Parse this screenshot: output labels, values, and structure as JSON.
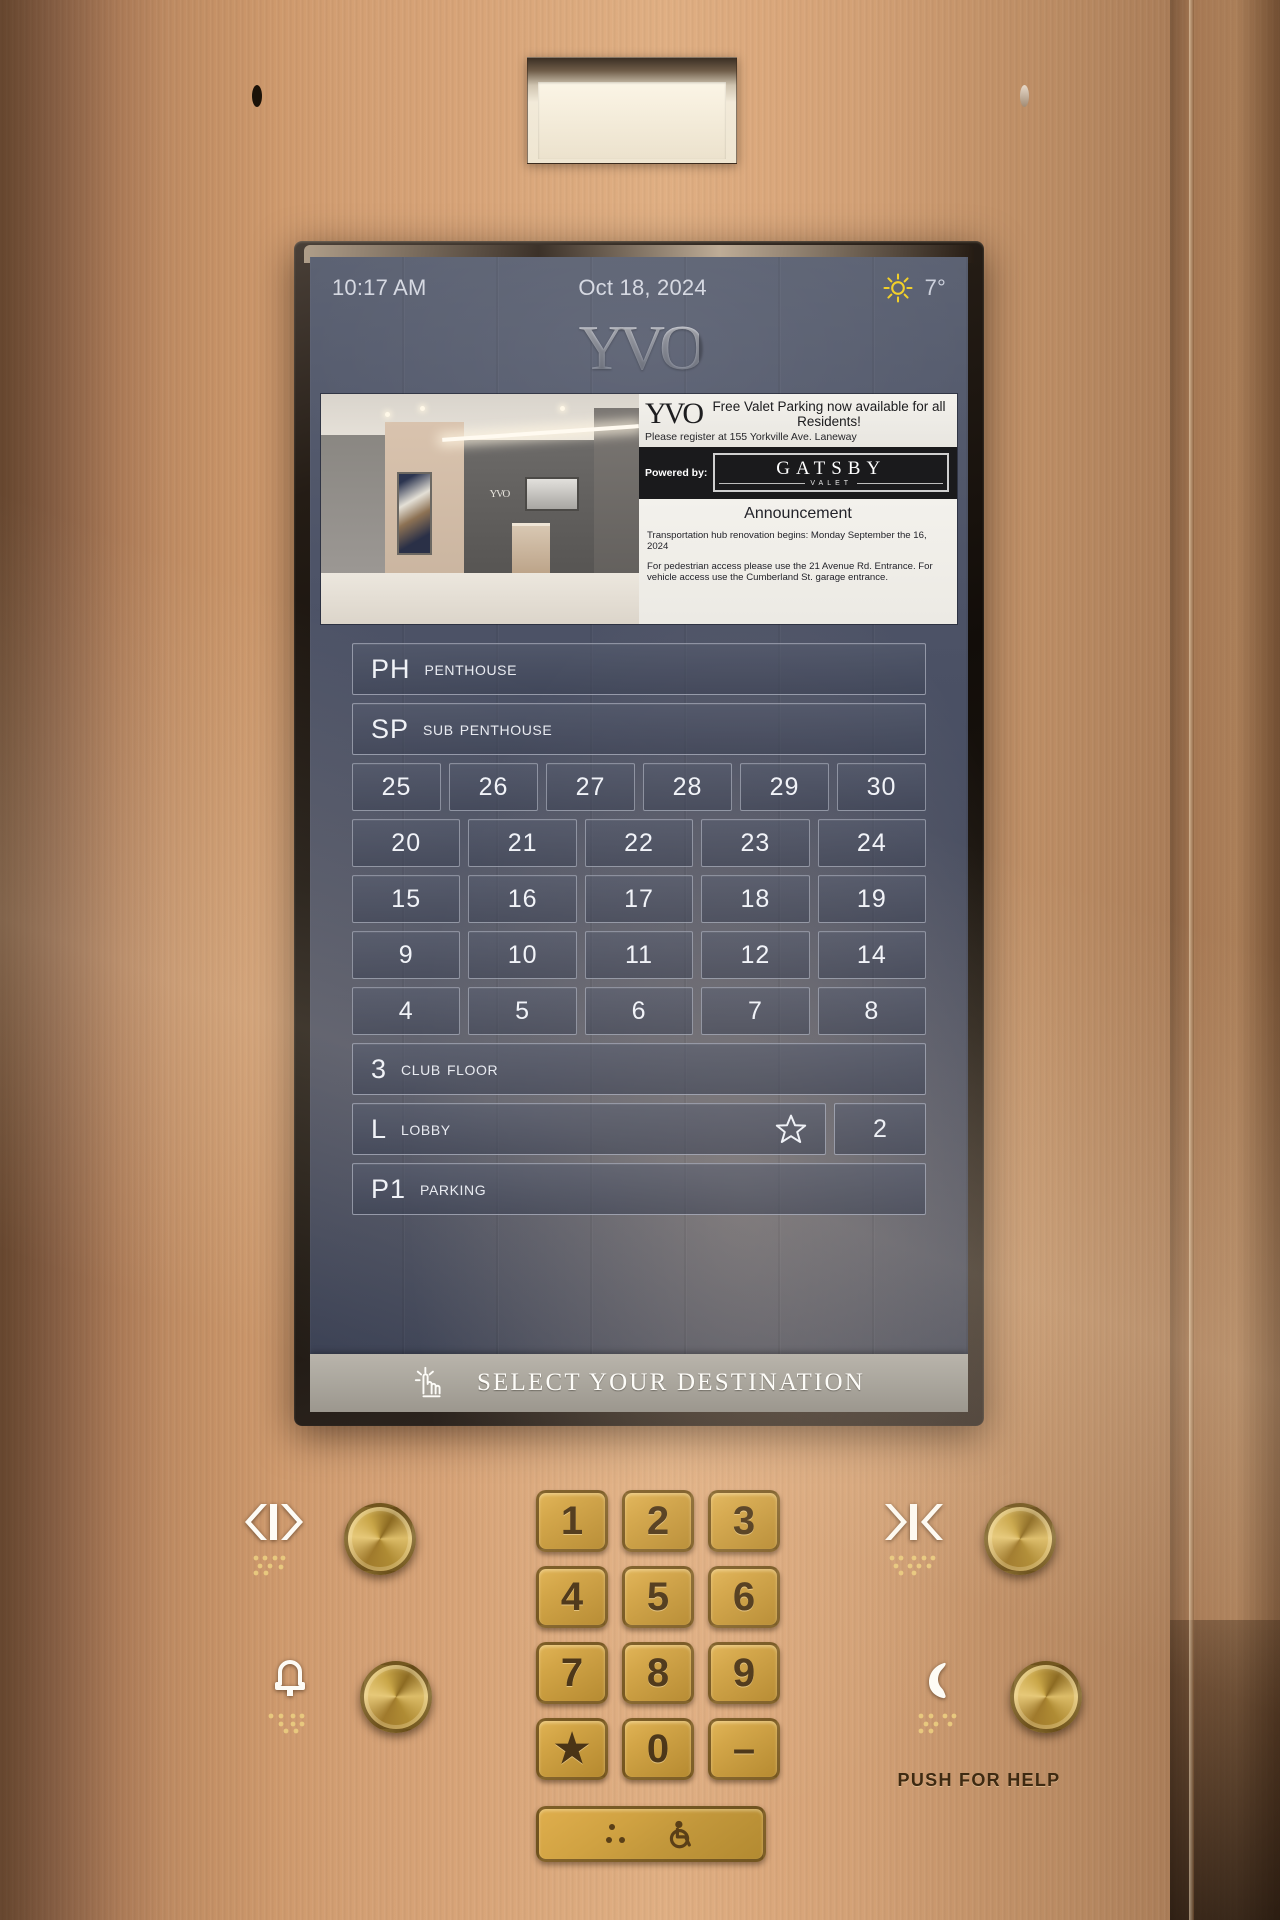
{
  "screen": {
    "status": {
      "time": "10:17 AM",
      "date": "Oct 18, 2024",
      "weather_icon": "sun-icon",
      "temperature": "7°"
    },
    "brand_logo": "YVO",
    "media": {
      "photo_alt": "lobby-render",
      "ad": {
        "logo": "YVO",
        "headline": "Free Valet Parking now available for all Residents!",
        "subline": "Please register at 155 Yorkville Ave. Laneway",
        "powered_by_label": "Powered by:",
        "partner_name": "GATSBY",
        "partner_sub": "VALET"
      },
      "announcement": {
        "title": "Announcement",
        "paragraphs": [
          "Transportation hub renovation begins: Monday September the 16, 2024",
          "For pedestrian access please use the 21 Avenue Rd. Entrance. For vehicle access use the Cumberland St. garage entrance."
        ]
      }
    },
    "floors": {
      "penthouse": {
        "code": "PH",
        "name": "Penthouse"
      },
      "sub_penthouse": {
        "code": "SP",
        "name": "Sub Penthouse"
      },
      "grid_rows": [
        [
          "25",
          "26",
          "27",
          "28",
          "29",
          "30"
        ],
        [
          "20",
          "21",
          "22",
          "23",
          "24"
        ],
        [
          "15",
          "16",
          "17",
          "18",
          "19"
        ],
        [
          "9",
          "10",
          "11",
          "12",
          "14"
        ],
        [
          "4",
          "5",
          "6",
          "7",
          "8"
        ]
      ],
      "club": {
        "code": "3",
        "name": "Club Floor"
      },
      "lobby": {
        "code": "L",
        "name": "Lobby",
        "icon": "star-icon"
      },
      "floor2": "2",
      "parking": {
        "code": "P1",
        "name": "Parking"
      }
    },
    "footer": {
      "icon": "tap-hand-icon",
      "label": "SELECT YOUR DESTINATION"
    }
  },
  "panel": {
    "keypad": [
      "1",
      "2",
      "3",
      "4",
      "5",
      "6",
      "7",
      "8",
      "9",
      "★",
      "0",
      "–"
    ],
    "accessible_button_icon": "wheelchair-icon",
    "left_buttons": [
      {
        "icon": "door-open-icon",
        "name": "door-open"
      },
      {
        "icon": "alarm-bell-icon",
        "name": "alarm"
      }
    ],
    "right_buttons": [
      {
        "icon": "door-close-icon",
        "name": "door-close"
      },
      {
        "icon": "phone-handset-icon",
        "name": "help-phone"
      }
    ],
    "help_label": "PUSH FOR HELP"
  },
  "colors": {
    "cab_metal": "#d4a074",
    "screen_bg": "#474d61",
    "accent_gold": "#d2a445",
    "weather_yellow": "#f2d02a",
    "footer_bar": "#aaa69d"
  }
}
